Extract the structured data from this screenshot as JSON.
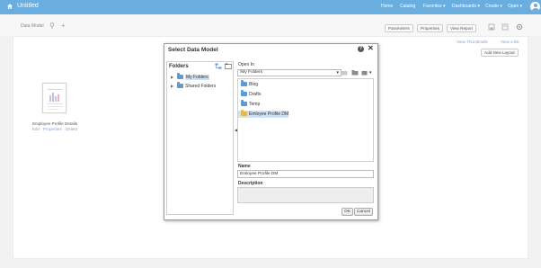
{
  "app": {
    "title": "Untitled",
    "nav": [
      "Home",
      "Catalog",
      "Favorites ▾",
      "Dashboards ▾",
      "Create ▾",
      "Open ▾"
    ]
  },
  "toolbar": {
    "breadcrumb": "Data Model",
    "buttons": [
      "Parameters",
      "Properties",
      "View Report"
    ]
  },
  "view_links": {
    "thumbnails": "View Thumbnails",
    "list": "View a list",
    "add_layout": "Add New Layout"
  },
  "report_thumb": {
    "title": "Employee Profile Details",
    "links": "Edit · Properties · Delete"
  },
  "dialog": {
    "title": "Select Data Model",
    "help": "?",
    "close": "✕",
    "folders_label": "Folders",
    "tree": [
      {
        "label": "My Folders",
        "selected": true
      },
      {
        "label": "Shared Folders",
        "selected": false
      }
    ],
    "open_in_label": "Open In",
    "open_in_value": "/My Folders",
    "items": [
      {
        "label": "Blog",
        "type": "folder"
      },
      {
        "label": "Drafts",
        "type": "folder"
      },
      {
        "label": "Temp",
        "type": "folder"
      },
      {
        "label": "Emloyee Profile DM",
        "type": "datamodel",
        "selected": true
      }
    ],
    "name_label": "Name",
    "name_value": "Emloyee Profile DM",
    "description_label": "Description",
    "ok_label": "OK",
    "cancel_label": "Cancel"
  }
}
